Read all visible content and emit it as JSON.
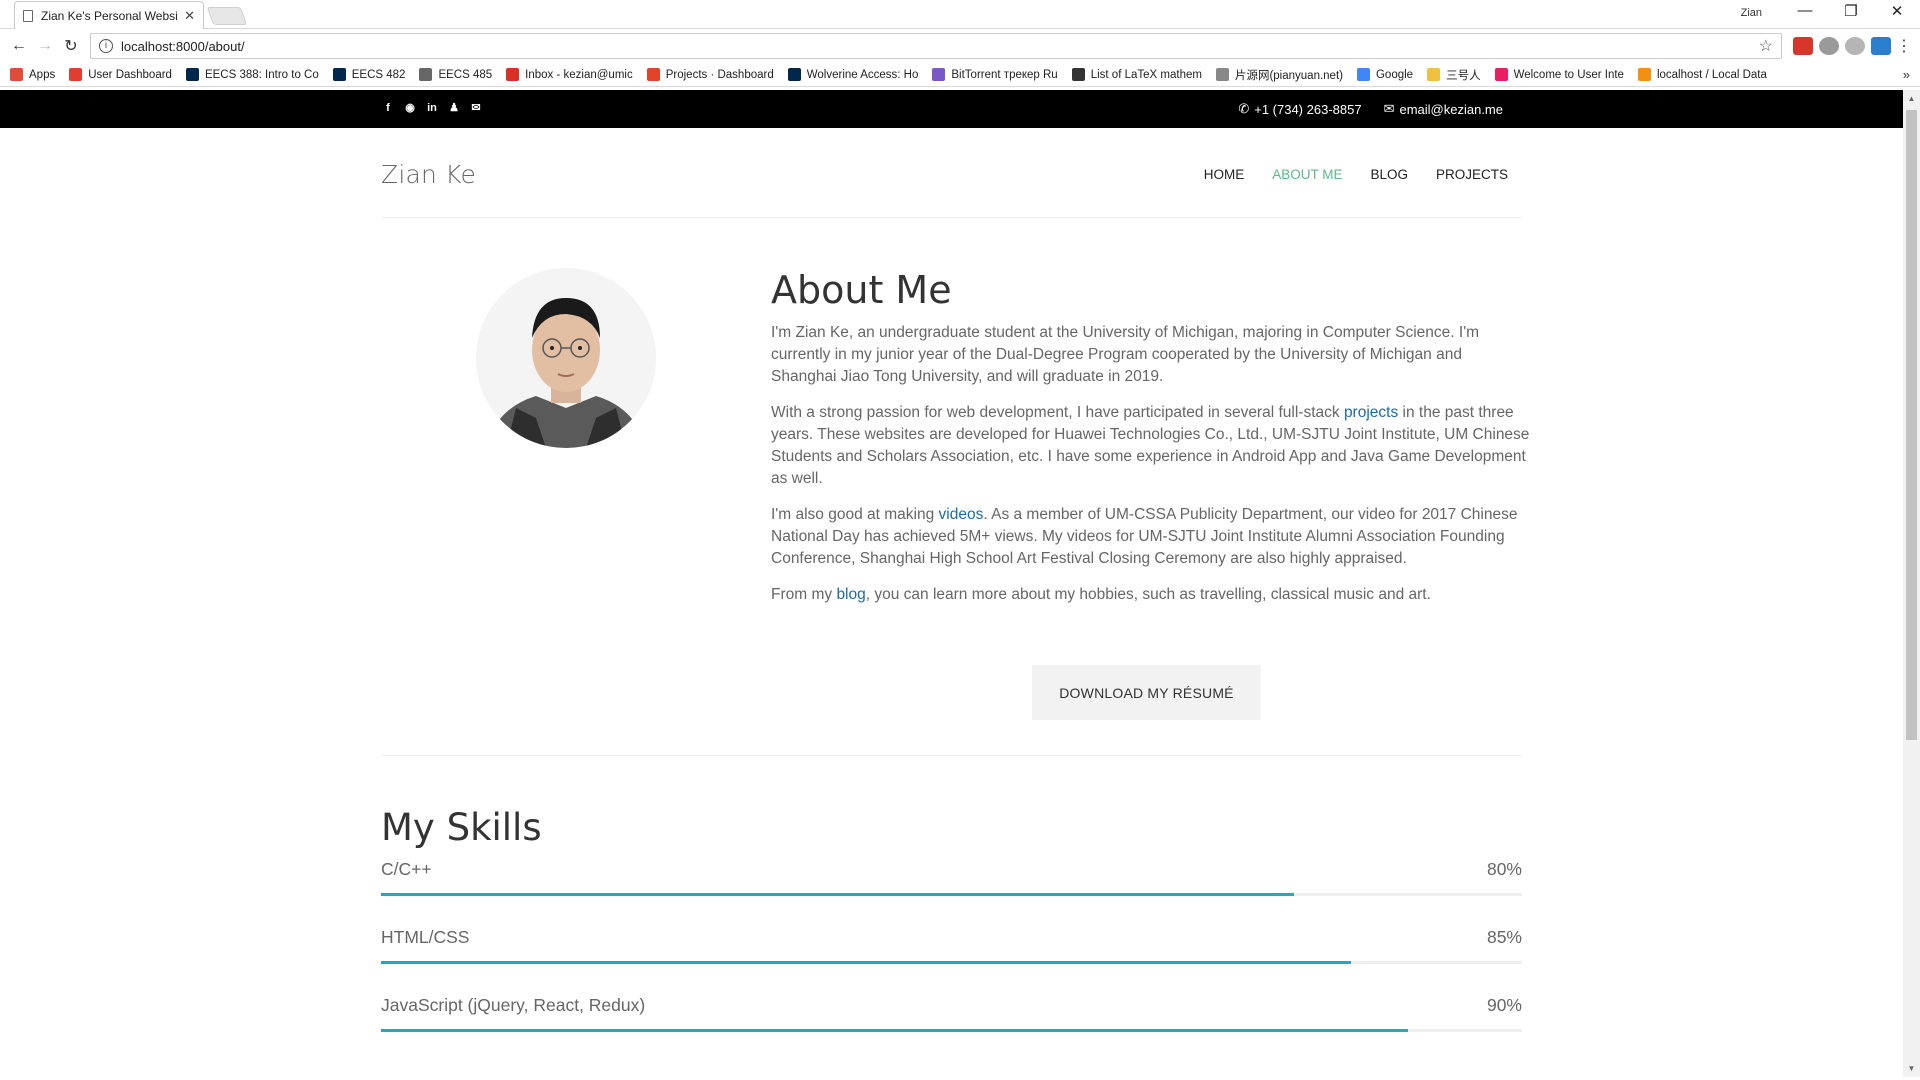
{
  "browser": {
    "tab_title": "Zian Ke's Personal Websi",
    "window_user": "Zian",
    "url_prefix": "localhost:8000/about/",
    "bookmarks": [
      {
        "label": "Apps",
        "icon": "apps-grid-icon",
        "color": "#e04b3a"
      },
      {
        "label": "User Dashboard",
        "icon": "gitlab-dashboard-icon",
        "color": "#e23e2f"
      },
      {
        "label": "EECS 388: Intro to Co",
        "icon": "umich-m-icon",
        "color": "#00274c"
      },
      {
        "label": "EECS 482",
        "icon": "umich-m-icon",
        "color": "#00274c"
      },
      {
        "label": "EECS 485",
        "icon": "globe-icon",
        "color": "#666666"
      },
      {
        "label": "Inbox - kezian@umic",
        "icon": "gmail-icon",
        "color": "#d93025"
      },
      {
        "label": "Projects · Dashboard",
        "icon": "gitlab-icon",
        "color": "#e24329"
      },
      {
        "label": "Wolverine Access: Ho",
        "icon": "umich-m-icon",
        "color": "#00274c"
      },
      {
        "label": "BitTorrent трекер Ru",
        "icon": "torrent-icon",
        "color": "#7a59c4"
      },
      {
        "label": "List of LaTeX mathem",
        "icon": "wikipedia-icon",
        "color": "#333333"
      },
      {
        "label": "片源网(pianyuan.net)",
        "icon": "page-icon",
        "color": "#888888"
      },
      {
        "label": "Google",
        "icon": "google-icon",
        "color": "#4285f4"
      },
      {
        "label": "三号人",
        "icon": "folder-icon",
        "color": "#f0c040"
      },
      {
        "label": "Welcome to User Inte",
        "icon": "pink-circle-icon",
        "color": "#e91e63"
      },
      {
        "label": "localhost / Local Data",
        "icon": "phpmyadmin-icon",
        "color": "#f29111"
      }
    ]
  },
  "topbar": {
    "social_icons": [
      "facebook-icon",
      "github-icon",
      "linkedin-icon",
      "qq-icon",
      "wechat-icon"
    ],
    "phone": "+1 (734) 263-8857",
    "email": "email@kezian.me"
  },
  "header": {
    "brand": "Zian Ke",
    "nav": [
      "HOME",
      "ABOUT ME",
      "BLOG",
      "PROJECTS"
    ],
    "active_nav": "ABOUT ME",
    "active_color": "#5cb88a"
  },
  "about": {
    "title": "About Me",
    "p1": "I'm Zian Ke, an undergraduate student at the University of Michigan, majoring in Computer Science. I'm currently in my junior year of the Dual-Degree Program cooperated by the University of Michigan and Shanghai Jiao Tong University, and will graduate in 2019.",
    "p2_before": "With a strong passion for web development, I have participated in several full-stack ",
    "p2_link": "projects",
    "p2_after": " in the past three years. These websites are developed for Huawei Technologies Co., Ltd., UM-SJTU Joint Institute, UM Chinese Students and Scholars Association, etc. I have some experience in Android App and Java Game Development as well.",
    "p3_before": "I'm also good at making ",
    "p3_link": "videos",
    "p3_after": ". As a member of UM-CSSA Publicity Department, our video for 2017 Chinese National Day has achieved 5M+ views. My videos for UM-SJTU Joint Institute Alumni Association Founding Conference, Shanghai High School Art Festival Closing Ceremony are also highly appraised.",
    "p4_before": "From my ",
    "p4_link": "blog",
    "p4_after": ", you can learn more about my hobbies, such as travelling, classical music and art.",
    "resume_button": "DOWNLOAD MY RÉSUMÉ",
    "link_color": "#1a6ab0"
  },
  "skills": {
    "title": "My Skills",
    "bar_color": "#20a8c8",
    "items": [
      {
        "name": "C/C++",
        "percent_label": "80%",
        "value": 80
      },
      {
        "name": "HTML/CSS",
        "percent_label": "85%",
        "value": 85
      },
      {
        "name": "JavaScript (jQuery, React, Redux)",
        "percent_label": "90%",
        "value": 90
      }
    ]
  }
}
